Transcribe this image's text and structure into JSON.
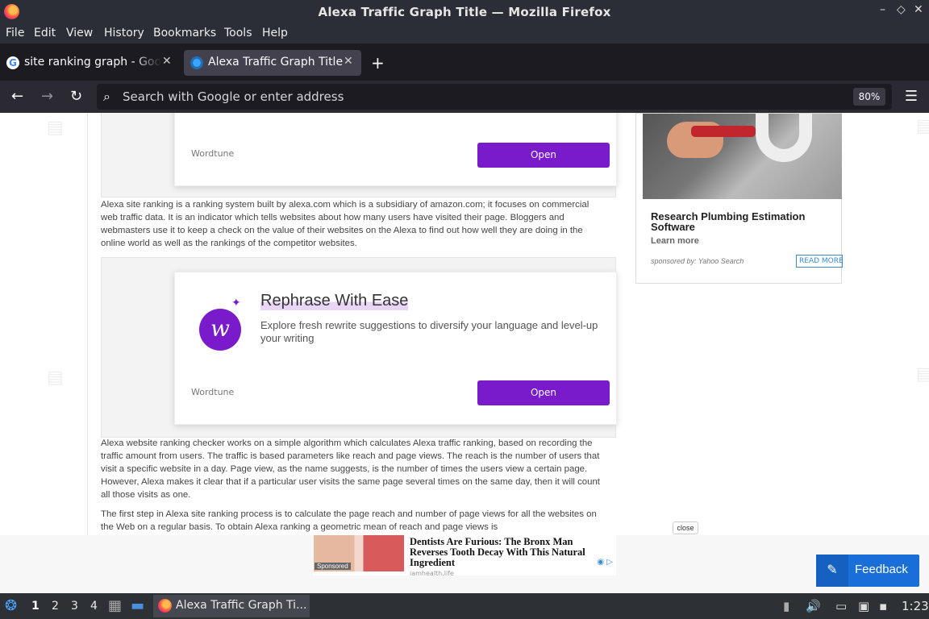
{
  "window": {
    "title": "Alexa Traffic Graph Title — Mozilla Firefox",
    "controls": {
      "minimize": "–",
      "restore": "◇",
      "close": "✕"
    }
  },
  "menubar": {
    "items": [
      "File",
      "Edit",
      "View",
      "History",
      "Bookmarks",
      "Tools",
      "Help"
    ]
  },
  "tabs": [
    {
      "label": "site ranking graph - Google Search",
      "close": "✕"
    },
    {
      "label": "Alexa Traffic Graph Title",
      "close": "✕"
    }
  ],
  "newtab": "+",
  "nav": {
    "back": "←",
    "forward": "→",
    "reload": "↻",
    "search_icon": "🔍",
    "placeholder": "Search with Google or enter address",
    "zoom": "80%",
    "menu": "☰"
  },
  "ads": {
    "wordtune_label": "Wordtune",
    "open_label": "Open",
    "rephrase_title": "Rephrase With Ease",
    "rephrase_sub": "Explore fresh rewrite suggestions to diversify your language and level-up your writing",
    "logo_letter": "w",
    "star": "✦"
  },
  "article": {
    "para1": "Alexa site ranking is a ranking system built by alexa.com which is a subsidiary of amazon.com; it focuses on commercial web traffic data. It is an indicator which tells websites about how many users have visited their page. Bloggers and webmasters use it to keep a check on the value of their websites on the Alexa to find out how well they are doing in the online world as well as the rankings of the competitor websites.",
    "para2": "Alexa website ranking checker works on a simple algorithm which calculates Alexa traffic ranking, based on recording the traffic amount from users. The traffic is based parameters like reach and page views. The reach is the number of users that visit a specific website in a day. Page view, as the name suggests, is the number of times the users view a certain page. However, Alexa makes it clear that if a particular user visits the same page several times on the same day, then it will count all those visits as one.",
    "para3": "The first step in Alexa site ranking process is to calculate the page reach and number of page views for all the websites on the Web on a regular basis. To obtain Alexa ranking a geometric mean of reach and page views is"
  },
  "sponsor": {
    "title": "Research Plumbing Estimation Software",
    "learn_more": "Learn more",
    "sponsored_by": "sponsored by: Yahoo Search",
    "read_more": "READ MORE"
  },
  "bottom_ad": {
    "close": "close",
    "sponsored": "Sponsored",
    "title": "Dentists Are Furious: The Bronx Man Reverses Tooth Decay With This Natural Ingredient",
    "source": "iamhealth.life",
    "adchoice": "◉ ▷"
  },
  "feedback": {
    "label": "Feedback",
    "icon": "✎"
  },
  "taskbar": {
    "workspaces": [
      "1",
      "2",
      "3",
      "4"
    ],
    "app_label": "Alexa Traffic Graph Ti...",
    "clock": "1:23",
    "volume": "🔊"
  }
}
